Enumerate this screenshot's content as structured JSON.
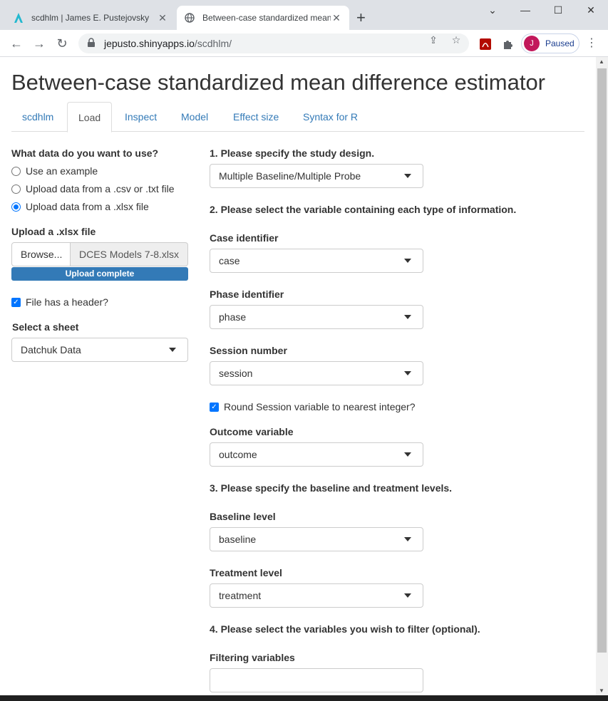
{
  "browser": {
    "tabs": [
      {
        "title": "scdhlm | James E. Pustejovsky",
        "active": false
      },
      {
        "title": "Between-case standardized mean difference estimator",
        "active": true
      }
    ],
    "url_host": "jepusto.shinyapps.io",
    "url_path": "/scdhlm/",
    "profile_initial": "J",
    "profile_status": "Paused",
    "colors": {
      "profile": "#c2185b",
      "accent": "#337ab7"
    }
  },
  "page": {
    "title": "Between-case standardized mean difference estimator",
    "nav_tabs": [
      "scdhlm",
      "Load",
      "Inspect",
      "Model",
      "Effect size",
      "Syntax for R"
    ],
    "active_tab": "Load"
  },
  "sidebar": {
    "data_question": "What data do you want to use?",
    "options": [
      "Use an example",
      "Upload data from a .csv or .txt file",
      "Upload data from a .xlsx file"
    ],
    "selected_option": "Upload data from a .xlsx file",
    "upload_label": "Upload a .xlsx file",
    "browse_label": "Browse...",
    "file_name": "DCES Models 7-8.xlsx",
    "upload_status": "Upload complete",
    "header_checkbox": "File has a header?",
    "sheet_label": "Select a sheet",
    "sheet_value": "Datchuk Data"
  },
  "main": {
    "step1": "1. Please specify the study design.",
    "design_value": "Multiple Baseline/Multiple Probe",
    "step2": "2. Please select the variable containing each type of information.",
    "case_label": "Case identifier",
    "case_value": "case",
    "phase_label": "Phase identifier",
    "phase_value": "phase",
    "session_label": "Session number",
    "session_value": "session",
    "round_checkbox": "Round Session variable to nearest integer?",
    "outcome_label": "Outcome variable",
    "outcome_value": "outcome",
    "step3": "3. Please specify the baseline and treatment levels.",
    "baseline_label": "Baseline level",
    "baseline_value": "baseline",
    "treatment_label": "Treatment level",
    "treatment_value": "treatment",
    "step4": "4. Please select the variables you wish to filter (optional).",
    "filter_label": "Filtering variables",
    "filter_value": ""
  }
}
